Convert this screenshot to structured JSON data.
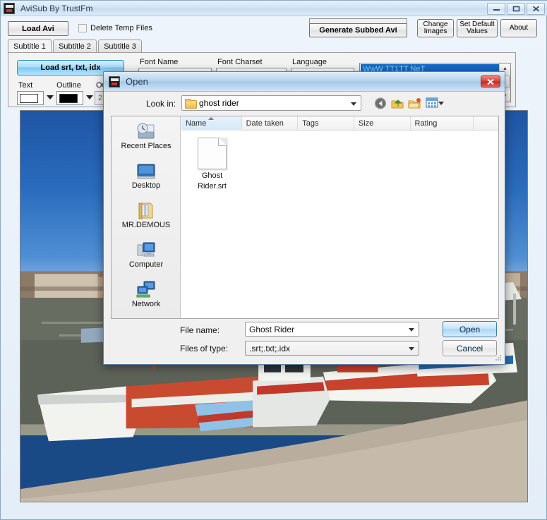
{
  "app": {
    "title": "AviSub By TrustFm",
    "icon": "app-icon",
    "window_buttons": {
      "minimize": "—",
      "maximize": "❐",
      "close": "✕"
    },
    "toolbar": {
      "load_avi": "Load Avi",
      "delete_temp_files": "Delete Temp Files",
      "generate_subbed_avi": "Generate Subbed Avi",
      "change_images": "Change\nImages",
      "change_images_line1": "Change",
      "change_images_line2": "Images",
      "set_default_line1": "Set Default",
      "set_default_line2": "Values",
      "about": "About"
    },
    "tabs": [
      {
        "label": "Subtitle 1",
        "active": true
      },
      {
        "label": "Subtitle 2",
        "active": false
      },
      {
        "label": "Subtitle 3",
        "active": false
      }
    ],
    "panel": {
      "load_srt_button": "Load srt, txt, idx",
      "labels": {
        "text": "Text",
        "outline": "Outline",
        "outline_width": "Outli",
        "font_name": "Font Name",
        "font_charset": "Font Charset",
        "language": "Language"
      },
      "values": {
        "text_color": "#ffffff",
        "outline_color": "#000000",
        "outline_width": "2",
        "font_name": "",
        "font_charset": "",
        "language": ""
      },
      "listbox_selected_item": "WwW TT1TT NeT"
    }
  },
  "dialog": {
    "title": "Open",
    "close_label": "✕",
    "look_in_label": "Look in:",
    "look_in_value": "ghost rider",
    "toolbar_icons": [
      "back-icon",
      "up-folder-icon",
      "new-folder-icon",
      "views-icon"
    ],
    "places": [
      {
        "label": "Recent Places",
        "icon": "recent-places-icon"
      },
      {
        "label": "Desktop",
        "icon": "desktop-icon"
      },
      {
        "label": "MR.DEMOUS",
        "icon": "user-folder-icon"
      },
      {
        "label": "Computer",
        "icon": "computer-icon"
      },
      {
        "label": "Network",
        "icon": "network-icon"
      }
    ],
    "columns": [
      {
        "label": "Name",
        "sorted": true
      },
      {
        "label": "Date taken",
        "sorted": false
      },
      {
        "label": "Tags",
        "sorted": false
      },
      {
        "label": "Size",
        "sorted": false
      },
      {
        "label": "Rating",
        "sorted": false
      }
    ],
    "files": [
      {
        "name_line1": "Ghost",
        "name_line2": "Rider.srt",
        "icon": "srt-file-icon"
      }
    ],
    "file_name_label": "File name:",
    "file_name_value": "Ghost Rider",
    "files_of_type_label": "Files of type:",
    "files_of_type_value": ".srt;.txt;.idx",
    "open_button": "Open",
    "cancel_button": "Cancel"
  },
  "preview": {
    "description": "harbor-photo-with-fishing-boats"
  },
  "colors": {
    "accent_blue": "#1569c7",
    "dialog_title": "#b9d5ee",
    "close_red": "#d9443a",
    "selection_text": "#7fd4ff"
  }
}
